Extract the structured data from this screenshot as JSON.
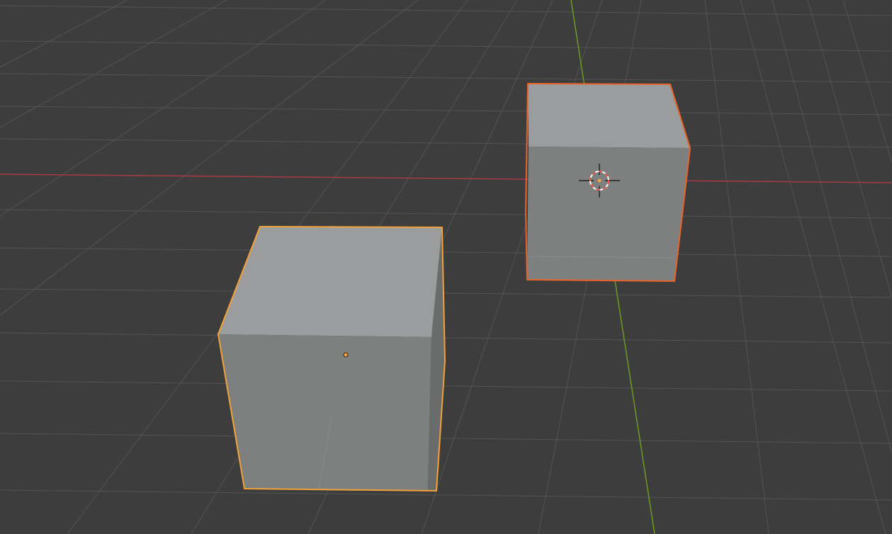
{
  "viewport": {
    "name": "3D Viewport",
    "shading": "solid",
    "background_color": "#3d3d3d",
    "grid_color": "#545454",
    "axes": {
      "x_axis_color": "#a83a44",
      "y_axis_color": "#6e9a23"
    }
  },
  "objects": [
    {
      "name": "cube-selected",
      "type": "mesh",
      "selected": true,
      "active": true,
      "outline_color": "#f2a23a",
      "origin_color": "#f2a23a"
    },
    {
      "name": "cube-secondary",
      "type": "mesh",
      "selected": true,
      "active": false,
      "outline_color": "#e8632c"
    }
  ],
  "cursor_3d": {
    "name": "3d-cursor",
    "ring_colors": [
      "#ffffff",
      "#e64a3c"
    ]
  },
  "face_colors": {
    "top": "#9a9c9d",
    "front": "#7e807f",
    "side": "#6a6c6b"
  }
}
